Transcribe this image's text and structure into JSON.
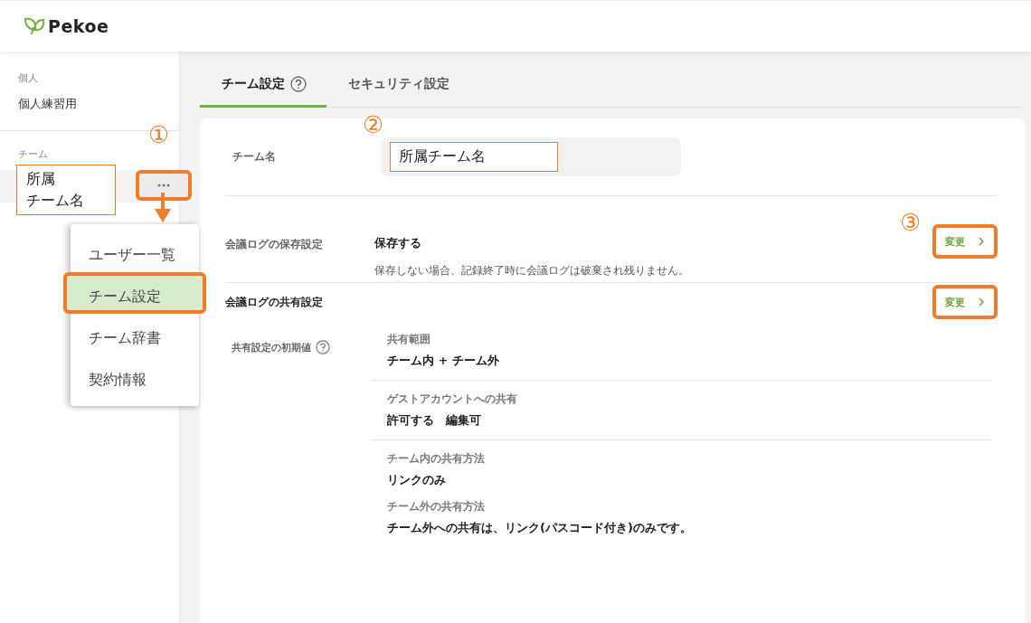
{
  "header": {
    "logo": "Pekoe"
  },
  "sidebar": {
    "personal": {
      "heading": "個人",
      "item": "個人練習用"
    },
    "team": {
      "heading": "チーム",
      "item_lines": [
        "所属",
        "チーム名"
      ],
      "highlighted": true,
      "callout": "①",
      "more_highlighted": true
    }
  },
  "menu": {
    "items": [
      {
        "label": "ユーザー一覧",
        "selected": false
      },
      {
        "label": "チーム設定",
        "selected": true
      },
      {
        "label": "チーム辞書",
        "selected": false
      },
      {
        "label": "契約情報",
        "selected": false
      }
    ]
  },
  "tabs": [
    {
      "label": "チーム設定",
      "selected": true,
      "help": true
    },
    {
      "label": "セキュリティ設定",
      "selected": false,
      "help": false
    }
  ],
  "team_name": {
    "label": "チーム名",
    "value": "所属チーム名",
    "callout": "②",
    "highlighted": true
  },
  "log_storage": {
    "label": "会議ログの保存設定",
    "value": "保存する",
    "note": "保存しない場合、記録終了時に会議ログは破棄され残りません。",
    "button": "変更",
    "callout": "③",
    "highlighted": true
  },
  "log_sharing": {
    "heading": "会議ログの共有設定",
    "button": "変更",
    "highlighted": true,
    "sublabel": "共有設定の初期値",
    "groups": [
      [
        {
          "label": "共有範囲",
          "value": "チーム内 + チーム外"
        }
      ],
      [
        {
          "label": "ゲストアカウントへの共有",
          "value": "許可する　編集可"
        }
      ],
      [
        {
          "label": "チーム内の共有方法",
          "value": "リンクのみ"
        },
        {
          "label": "チーム外の共有方法",
          "value": "チーム外への共有は、リンク(パスコード付き)のみです。"
        }
      ]
    ]
  }
}
